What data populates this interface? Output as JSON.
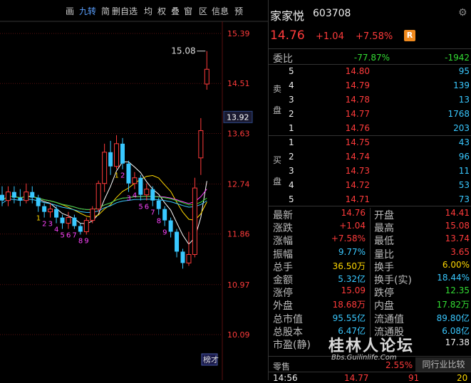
{
  "toolbar": {
    "items": [
      "画",
      "九转",
      "简",
      "删自选",
      "均",
      "权",
      "叠",
      "窗",
      "区",
      "信息",
      "预"
    ],
    "active_index": 1
  },
  "chart": {
    "price_ticks": [
      "15.39",
      "14.51",
      "13.63",
      "12.74",
      "11.86",
      "10.97",
      "10.09"
    ],
    "current_price_label": "13.92",
    "high_label": "15.08",
    "tag_label": "榜才"
  },
  "chart_data": {
    "type": "candlestick",
    "ylim": [
      9.8,
      15.6
    ],
    "candles": [
      {
        "o": 12.55,
        "c": 12.45,
        "h": 12.7,
        "l": 12.35
      },
      {
        "o": 12.45,
        "c": 12.6,
        "h": 12.7,
        "l": 12.35
      },
      {
        "o": 12.6,
        "c": 12.5,
        "h": 12.7,
        "l": 12.4
      },
      {
        "o": 12.5,
        "c": 12.45,
        "h": 12.65,
        "l": 12.35
      },
      {
        "o": 12.45,
        "c": 12.6,
        "h": 12.75,
        "l": 12.4
      },
      {
        "o": 12.6,
        "c": 12.5,
        "h": 12.7,
        "l": 12.4
      },
      {
        "o": 12.5,
        "c": 12.35,
        "h": 12.55,
        "l": 12.25
      },
      {
        "o": 12.35,
        "c": 12.25,
        "h": 12.4,
        "l": 12.15
      },
      {
        "o": 12.25,
        "c": 12.3,
        "h": 12.4,
        "l": 12.15
      },
      {
        "o": 12.3,
        "c": 12.15,
        "h": 12.35,
        "l": 12.05
      },
      {
        "o": 12.15,
        "c": 12.05,
        "h": 12.2,
        "l": 11.95
      },
      {
        "o": 12.05,
        "c": 12.15,
        "h": 12.25,
        "l": 11.95
      },
      {
        "o": 12.15,
        "c": 12.0,
        "h": 12.2,
        "l": 11.95
      },
      {
        "o": 12.0,
        "c": 11.9,
        "h": 12.05,
        "l": 11.85
      },
      {
        "o": 11.9,
        "c": 12.1,
        "h": 12.15,
        "l": 11.85
      },
      {
        "o": 12.1,
        "c": 12.3,
        "h": 12.35,
        "l": 12.05
      },
      {
        "o": 12.3,
        "c": 12.75,
        "h": 12.8,
        "l": 12.25
      },
      {
        "o": 12.75,
        "c": 13.3,
        "h": 13.45,
        "l": 12.6
      },
      {
        "o": 13.3,
        "c": 13.05,
        "h": 13.5,
        "l": 12.9
      },
      {
        "o": 13.05,
        "c": 13.45,
        "h": 13.6,
        "l": 13.0
      },
      {
        "o": 13.45,
        "c": 13.1,
        "h": 13.55,
        "l": 13.0
      },
      {
        "o": 13.1,
        "c": 12.75,
        "h": 13.15,
        "l": 12.6
      },
      {
        "o": 12.75,
        "c": 12.85,
        "h": 12.95,
        "l": 12.65
      },
      {
        "o": 12.85,
        "c": 12.55,
        "h": 12.9,
        "l": 12.45
      },
      {
        "o": 12.55,
        "c": 12.65,
        "h": 12.75,
        "l": 12.45
      },
      {
        "o": 12.65,
        "c": 12.45,
        "h": 12.7,
        "l": 12.35
      },
      {
        "o": 12.45,
        "c": 12.3,
        "h": 12.5,
        "l": 12.2
      },
      {
        "o": 12.3,
        "c": 12.1,
        "h": 12.35,
        "l": 12.0
      },
      {
        "o": 12.1,
        "c": 11.9,
        "h": 12.15,
        "l": 11.8
      },
      {
        "o": 11.9,
        "c": 11.55,
        "h": 11.95,
        "l": 11.45
      },
      {
        "o": 11.55,
        "c": 11.35,
        "h": 11.6,
        "l": 11.25
      },
      {
        "o": 11.35,
        "c": 11.5,
        "h": 11.9,
        "l": 11.3
      },
      {
        "o": 11.5,
        "c": 12.67,
        "h": 12.85,
        "l": 11.45
      },
      {
        "o": 13.2,
        "c": 13.68,
        "h": 13.9,
        "l": 12.9
      },
      {
        "o": 14.5,
        "c": 14.76,
        "h": 15.08,
        "l": 14.4
      }
    ]
  },
  "stock": {
    "name": "家家悦",
    "code": "603708",
    "price": "14.76",
    "change": "+1.04",
    "change_pct": "+7.58%",
    "badge": "R",
    "weibi_label": "委比",
    "weibi_pct": "-77.87%",
    "weibi_diff": "-1942"
  },
  "orderbook": {
    "sell_label": [
      "卖",
      "盘"
    ],
    "buy_label": [
      "买",
      "盘"
    ],
    "sells": [
      {
        "level": "5",
        "price": "14.80",
        "vol": "95"
      },
      {
        "level": "4",
        "price": "14.79",
        "vol": "139"
      },
      {
        "level": "3",
        "price": "14.78",
        "vol": "13"
      },
      {
        "level": "2",
        "price": "14.77",
        "vol": "1768"
      },
      {
        "level": "1",
        "price": "14.76",
        "vol": "203"
      }
    ],
    "buys": [
      {
        "level": "1",
        "price": "14.75",
        "vol": "43"
      },
      {
        "level": "2",
        "price": "14.74",
        "vol": "96"
      },
      {
        "level": "3",
        "price": "14.73",
        "vol": "11"
      },
      {
        "level": "4",
        "price": "14.72",
        "vol": "53"
      },
      {
        "level": "5",
        "price": "14.71",
        "vol": "73"
      }
    ]
  },
  "stats": [
    {
      "l1": "最新",
      "v1": "14.76",
      "c1": "red",
      "l2": "开盘",
      "v2": "14.41",
      "c2": "red"
    },
    {
      "l1": "涨跌",
      "v1": "+1.04",
      "c1": "red",
      "l2": "最高",
      "v2": "15.08",
      "c2": "red"
    },
    {
      "l1": "涨幅",
      "v1": "+7.58%",
      "c1": "red",
      "l2": "最低",
      "v2": "13.74",
      "c2": "red"
    },
    {
      "l1": "振幅",
      "v1": "9.77%",
      "c1": "cyan",
      "l2": "量比",
      "v2": "3.65",
      "c2": "red"
    },
    {
      "l1": "总手",
      "v1": "36.50万",
      "c1": "yellow",
      "l2": "换手",
      "v2": "6.00%",
      "c2": "yellow"
    },
    {
      "l1": "金额",
      "v1": "5.32亿",
      "c1": "cyan",
      "l2": "换手(实)",
      "v2": "18.44%",
      "c2": "cyan"
    },
    {
      "l1": "涨停",
      "v1": "15.09",
      "c1": "red",
      "l2": "跌停",
      "v2": "12.35",
      "c2": "green"
    },
    {
      "l1": "外盘",
      "v1": "18.68万",
      "c1": "red",
      "l2": "内盘",
      "v2": "17.82万",
      "c2": "green"
    },
    {
      "l1": "总市值",
      "v1": "95.55亿",
      "c1": "cyan",
      "l2": "流通值",
      "v2": "89.80亿",
      "c2": "cyan"
    },
    {
      "l1": "总股本",
      "v1": "6.47亿",
      "c1": "cyan",
      "l2": "流通股",
      "v2": "6.08亿",
      "c2": "cyan"
    },
    {
      "l1": "市盈(静)",
      "v1": "",
      "c1": "cyan",
      "l2": "",
      "v2": "17.38",
      "c2": "white"
    }
  ],
  "bottom": {
    "label": "零售",
    "pct": "2.55%",
    "compare_button": "同行业比较",
    "trade_time": "14:56",
    "trade_price": "14.77",
    "trade_vol": "91",
    "trade_extra": "20"
  },
  "watermark": {
    "main": "桂林人论坛",
    "url": "Bbs.Guilinlife.Com"
  }
}
